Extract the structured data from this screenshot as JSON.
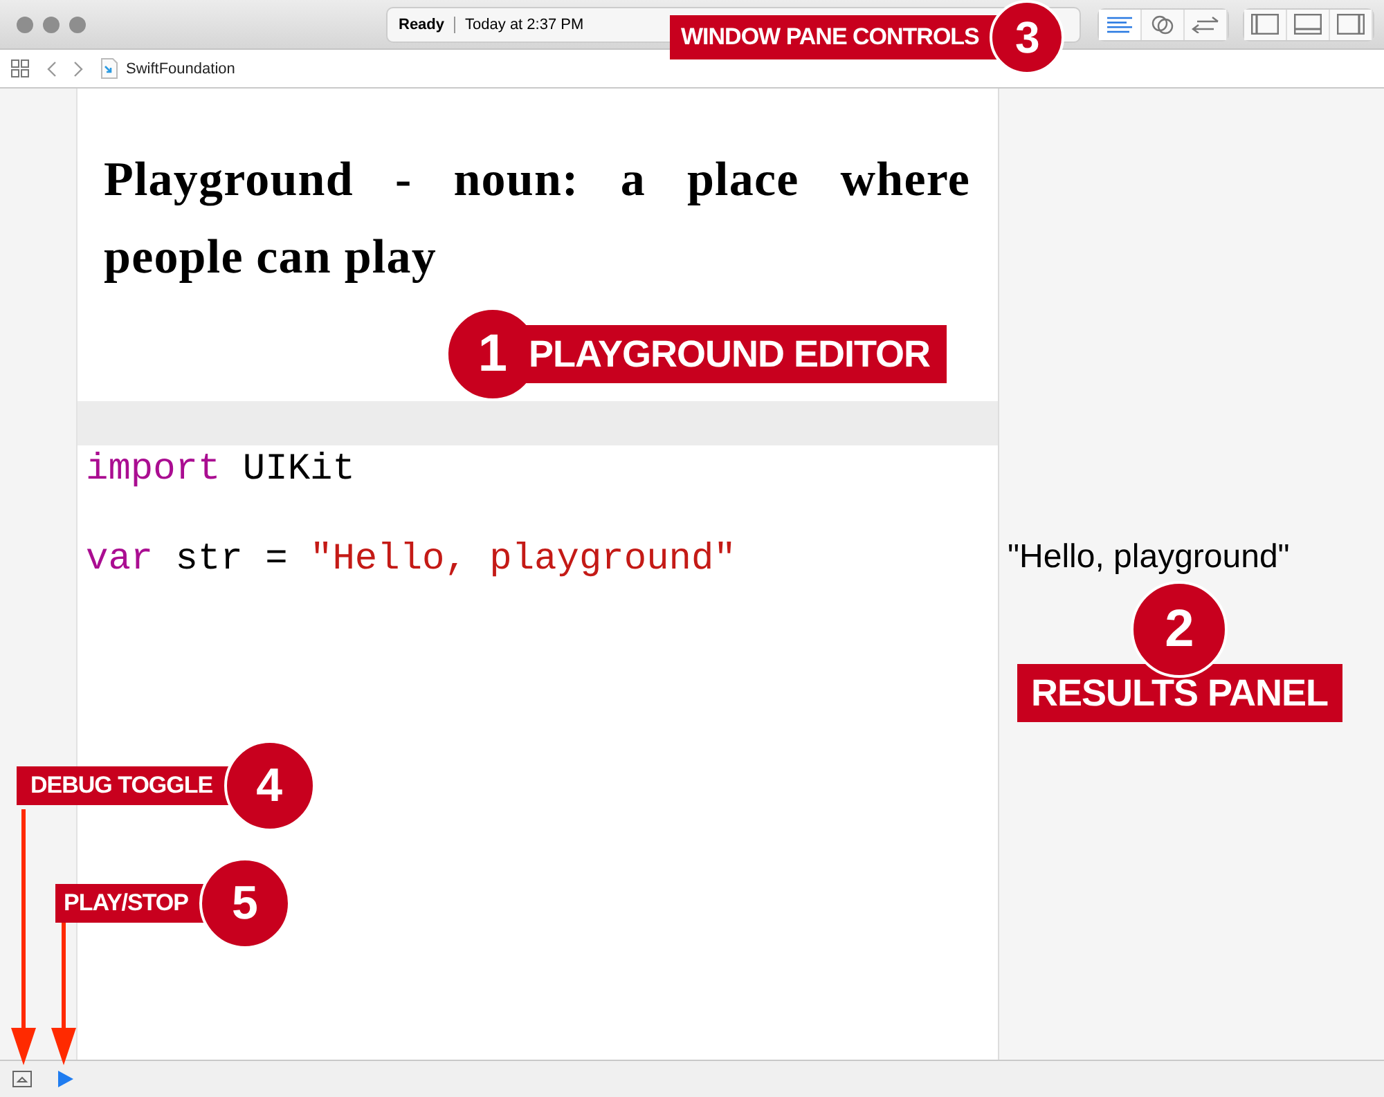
{
  "window": {
    "status": "Ready",
    "time": "Today at 2:37 PM"
  },
  "editor_modes": [
    {
      "kind": "standard",
      "selected": true
    },
    {
      "kind": "assistant",
      "selected": false
    },
    {
      "kind": "version",
      "selected": false
    }
  ],
  "panel_toggles": [
    {
      "kind": "left"
    },
    {
      "kind": "bottom"
    },
    {
      "kind": "right"
    }
  ],
  "breadcrumb": {
    "file": "SwiftFoundation"
  },
  "editor": {
    "heading": "Playground - noun: a place where people can play",
    "lines": [
      [
        {
          "kind": "keyword",
          "text": "import"
        },
        {
          "kind": "plain",
          "text": " UIKit"
        }
      ],
      [
        {
          "kind": "keyword",
          "text": "var"
        },
        {
          "kind": "plain",
          "text": " str = "
        },
        {
          "kind": "string",
          "text": "\"Hello, playground\""
        }
      ]
    ]
  },
  "results": [
    {
      "text": "\"Hello, playground\""
    }
  ],
  "callouts": [
    {
      "number": "1",
      "label": "PLAYGROUND EDITOR"
    },
    {
      "number": "2",
      "label": "RESULTS PANEL"
    },
    {
      "number": "3",
      "label": "WINDOW PANE CONTROLS"
    },
    {
      "number": "4",
      "label": "DEBUG TOGGLE"
    },
    {
      "number": "5",
      "label": "PLAY/STOP"
    }
  ]
}
